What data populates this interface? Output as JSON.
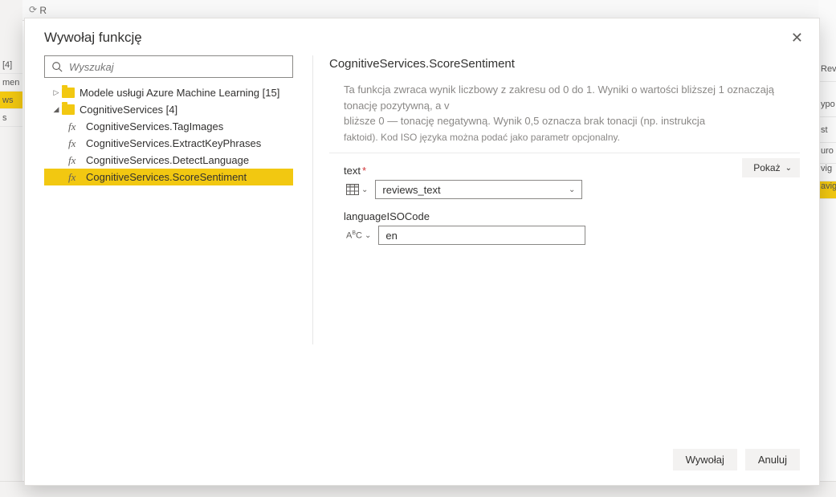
{
  "bg": {
    "header_glyph": "R",
    "left_labels": [
      "[4]",
      "men",
      "ws",
      "s"
    ],
    "right_labels": [
      "Rev",
      "ypo",
      "st",
      "uro",
      "vig",
      "avig"
    ]
  },
  "dialog": {
    "title": "Wywołaj funkcję",
    "search_placeholder": "Wyszukaj"
  },
  "tree": {
    "root1": "Modele usługi Azure Machine Learning [15]",
    "root2": "CognitiveServices  [4]",
    "items": [
      "CognitiveServices.TagImages",
      "CognitiveServices.ExtractKeyPhrases",
      "CognitiveServices.DetectLanguage",
      "CognitiveServices.ScoreSentiment"
    ]
  },
  "detail": {
    "title": "CognitiveServices.ScoreSentiment",
    "desc_line1": "Ta funkcja zwraca wynik liczbowy z zakresu od 0 do 1. Wyniki o wartości bliższej 1 oznaczają tonację pozytywną, a v",
    "desc_line2": "bliższe 0 — tonację negatywną. Wynik 0,5 oznacza brak tonacji (np. instrukcja",
    "desc_line3": "faktoid). Kod ISO języka można podać jako parametr opcjonalny.",
    "show_label": "Pokaż",
    "params": {
      "text_label": "text",
      "text_value": "reviews_text",
      "lang_label": "languageISOCode",
      "lang_value": "en"
    }
  },
  "buttons": {
    "invoke": "Wywołaj",
    "cancel": "Anuluj"
  }
}
